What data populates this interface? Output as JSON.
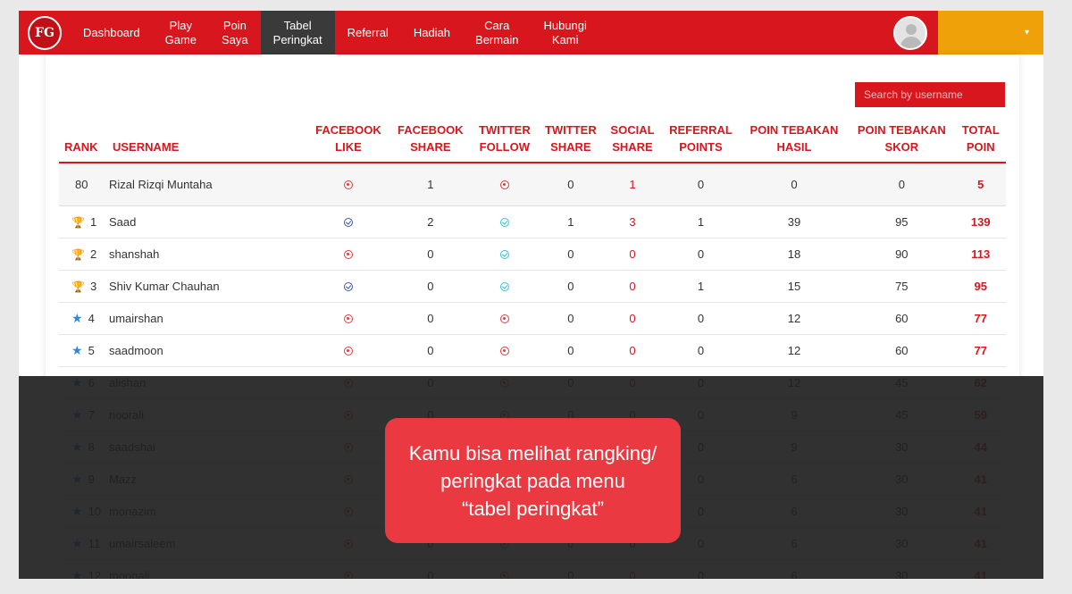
{
  "nav": {
    "logo_text": "FG",
    "items": [
      {
        "label": "Dashboard"
      },
      {
        "label": "Play\nGame"
      },
      {
        "label": "Poin\nSaya"
      },
      {
        "label": "Tabel\nPeringkat"
      },
      {
        "label": "Referral"
      },
      {
        "label": "Hadiah"
      },
      {
        "label": "Cara\nBermain"
      },
      {
        "label": "Hubungi\nKami"
      }
    ],
    "active_index": 3,
    "dropdown_caret": "▾"
  },
  "search": {
    "placeholder": "Search by username"
  },
  "table": {
    "headers": [
      "RANK",
      "USERNAME",
      "FACEBOOK\nLIKE",
      "FACEBOOK\nSHARE",
      "TWITTER\nFOLLOW",
      "TWITTER\nSHARE",
      "SOCIAL\nSHARE",
      "REFERRAL\nPOINTS",
      "POIN TEBAKAN\nHASIL",
      "POIN TEBAKAN\nSKOR",
      "TOTAL\nPOIN"
    ],
    "current_user": {
      "rank": "80",
      "username": "Rizal Rizqi Muntaha",
      "fb_like": "no",
      "fb_share": "1",
      "tw_follow": "no",
      "tw_share": "0",
      "social_share": "1",
      "referral": "0",
      "hasil": "0",
      "skor": "0",
      "total": "5"
    },
    "rows": [
      {
        "rank": "1",
        "badge": "trophy-gold",
        "username": "Saad",
        "fb_like": "ok",
        "fb_share": "2",
        "tw_follow": "ok",
        "tw_share": "1",
        "social_share": "3",
        "referral": "1",
        "hasil": "39",
        "skor": "95",
        "total": "139"
      },
      {
        "rank": "2",
        "badge": "trophy-silver",
        "username": "shanshah",
        "fb_like": "no",
        "fb_share": "0",
        "tw_follow": "ok",
        "tw_share": "0",
        "social_share": "0",
        "referral": "0",
        "hasil": "18",
        "skor": "90",
        "total": "113"
      },
      {
        "rank": "3",
        "badge": "trophy-gold",
        "username": "Shiv Kumar Chauhan",
        "fb_like": "ok",
        "fb_share": "0",
        "tw_follow": "ok",
        "tw_share": "0",
        "social_share": "0",
        "referral": "1",
        "hasil": "15",
        "skor": "75",
        "total": "95"
      },
      {
        "rank": "4",
        "badge": "star",
        "username": "umairshan",
        "fb_like": "no",
        "fb_share": "0",
        "tw_follow": "no",
        "tw_share": "0",
        "social_share": "0",
        "referral": "0",
        "hasil": "12",
        "skor": "60",
        "total": "77"
      },
      {
        "rank": "5",
        "badge": "star",
        "username": "saadmoon",
        "fb_like": "no",
        "fb_share": "0",
        "tw_follow": "no",
        "tw_share": "0",
        "social_share": "0",
        "referral": "0",
        "hasil": "12",
        "skor": "60",
        "total": "77"
      },
      {
        "rank": "6",
        "badge": "star",
        "username": "alishan",
        "fb_like": "no",
        "fb_share": "0",
        "tw_follow": "no",
        "tw_share": "0",
        "social_share": "0",
        "referral": "0",
        "hasil": "12",
        "skor": "45",
        "total": "62"
      },
      {
        "rank": "7",
        "badge": "star",
        "username": "noorali",
        "fb_like": "no",
        "fb_share": "0",
        "tw_follow": "no",
        "tw_share": "0",
        "social_share": "0",
        "referral": "0",
        "hasil": "9",
        "skor": "45",
        "total": "59"
      },
      {
        "rank": "8",
        "badge": "star",
        "username": "saadshai",
        "fb_like": "no",
        "fb_share": "0",
        "tw_follow": "no",
        "tw_share": "0",
        "social_share": "0",
        "referral": "0",
        "hasil": "9",
        "skor": "30",
        "total": "44"
      },
      {
        "rank": "9",
        "badge": "star",
        "username": "Mazz",
        "fb_like": "no",
        "fb_share": "0",
        "tw_follow": "no",
        "tw_share": "0",
        "social_share": "0",
        "referral": "0",
        "hasil": "6",
        "skor": "30",
        "total": "41"
      },
      {
        "rank": "10",
        "badge": "star",
        "username": "monazim",
        "fb_like": "no",
        "fb_share": "0",
        "tw_follow": "no",
        "tw_share": "0",
        "social_share": "0",
        "referral": "0",
        "hasil": "6",
        "skor": "30",
        "total": "41"
      },
      {
        "rank": "11",
        "badge": "star",
        "username": "umairsaleem",
        "fb_like": "no",
        "fb_share": "0",
        "tw_follow": "no",
        "tw_share": "0",
        "social_share": "0",
        "referral": "0",
        "hasil": "6",
        "skor": "30",
        "total": "41"
      },
      {
        "rank": "12",
        "badge": "star",
        "username": "moonali",
        "fb_like": "no",
        "fb_share": "0",
        "tw_follow": "no",
        "tw_share": "0",
        "social_share": "0",
        "referral": "0",
        "hasil": "6",
        "skor": "30",
        "total": "41"
      }
    ]
  },
  "callout": {
    "line1": "Kamu bisa melihat rangking/",
    "line2": "peringkat pada menu",
    "line3": "“tabel peringkat”"
  },
  "colors": {
    "brand_red": "#d7161e",
    "active_nav": "#3a3a3a",
    "user_dropdown": "#efa10a",
    "overlay": "#202020",
    "callout": "#ea3940"
  }
}
